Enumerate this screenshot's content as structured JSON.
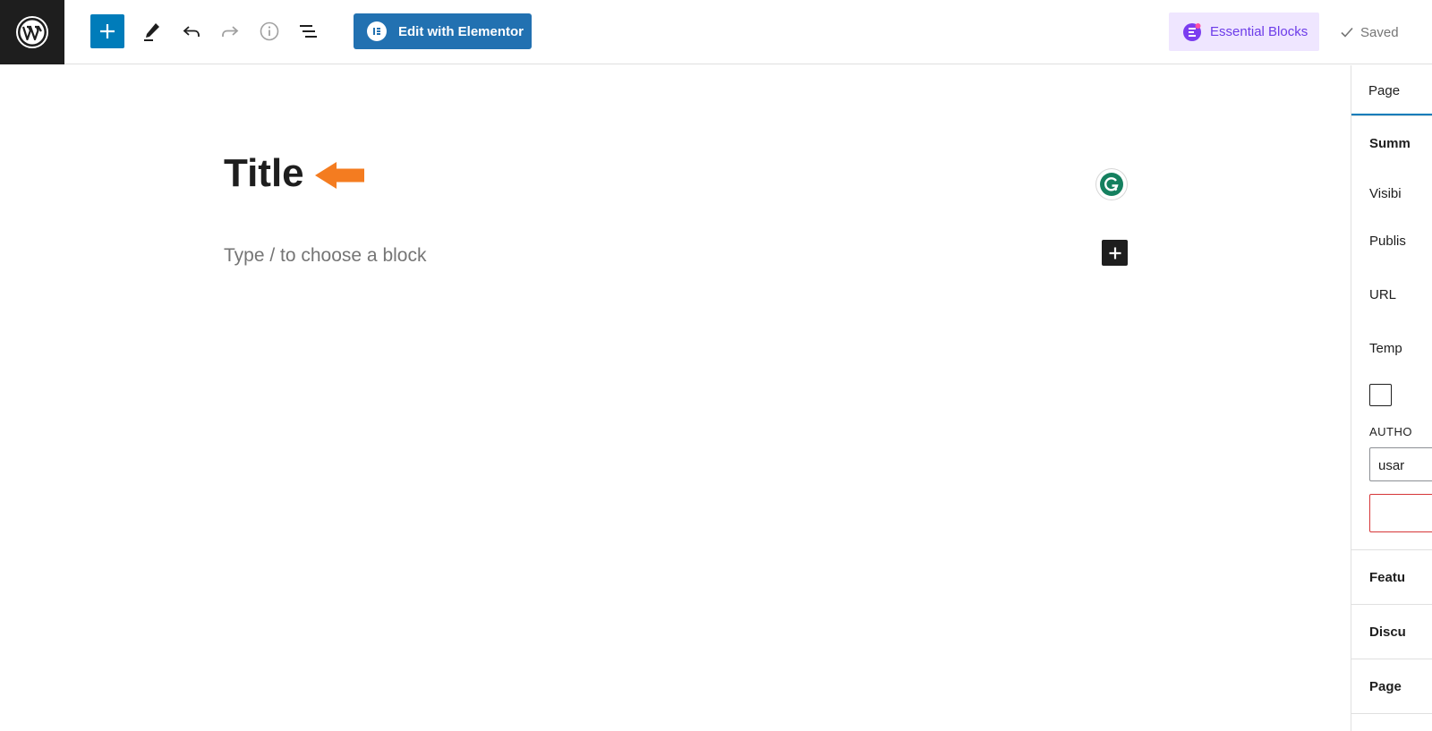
{
  "toolbar": {
    "edit_elementor_label": "Edit with Elementor",
    "essential_blocks_label": "Essential Blocks",
    "saved_label": "Saved",
    "icons": [
      "wordpress-logo",
      "plus",
      "pencil",
      "undo",
      "redo",
      "info",
      "list-view"
    ]
  },
  "editor": {
    "title": "Title",
    "block_placeholder": "Type / to choose a block"
  },
  "sidebar": {
    "tab_page": "Page",
    "summary": "Summ",
    "visibility": "Visibi",
    "publish": "Publis",
    "url": "URL",
    "template": "Temp",
    "author_label": "AUTHO",
    "author_value": "usar",
    "featured": "Featu",
    "discussion": "Discu",
    "page_attributes": "Page"
  },
  "colors": {
    "primary": "#007cba",
    "elementor": "#2271b1",
    "essential_bg": "#efe6ff",
    "arrow": "#f47c20",
    "grammarly": "#15805f"
  }
}
